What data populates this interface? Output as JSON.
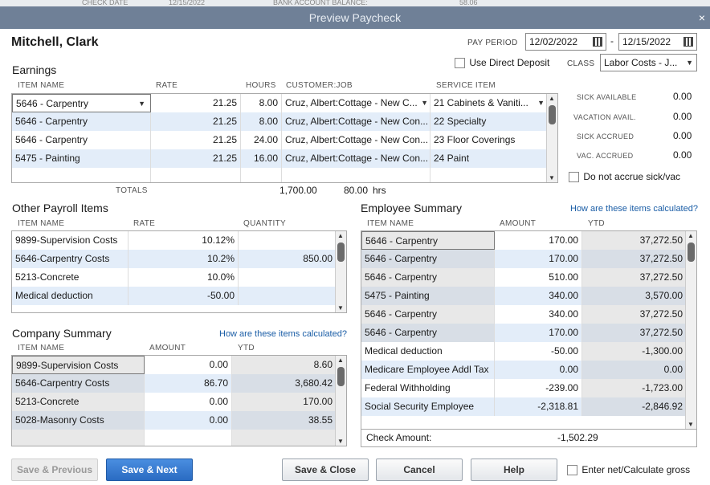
{
  "window": {
    "title": "Preview Paycheck",
    "close": "×"
  },
  "background_strip": {
    "check_date": "CHECK DATE",
    "date": "12/15/2022",
    "bank_balance": "BANK ACCOUNT BALANCE:",
    "balance_value": "58.06"
  },
  "employee": {
    "name": "Mitchell, Clark"
  },
  "pay_period": {
    "label": "PAY PERIOD",
    "start": "12/02/2022",
    "sep": "-",
    "end": "12/15/2022"
  },
  "direct_deposit": {
    "label": "Use Direct Deposit",
    "checked": false
  },
  "class": {
    "label": "CLASS",
    "value": "Labor Costs - J..."
  },
  "earnings": {
    "title": "Earnings",
    "headers": [
      "ITEM NAME",
      "RATE",
      "HOURS",
      "CUSTOMER:JOB",
      "SERVICE ITEM"
    ],
    "rows": [
      {
        "item": "5646 - Carpentry",
        "rate": "21.25",
        "hours": "8.00",
        "job": "Cruz, Albert:Cottage - New C...",
        "service": "21 Cabinets & Vaniti..."
      },
      {
        "item": "5646 - Carpentry",
        "rate": "21.25",
        "hours": "8.00",
        "job": "Cruz, Albert:Cottage - New Con...",
        "service": "22 Specialty"
      },
      {
        "item": "5646 - Carpentry",
        "rate": "21.25",
        "hours": "24.00",
        "job": "Cruz, Albert:Cottage - New Con...",
        "service": "23 Floor Coverings"
      },
      {
        "item": "5475 - Painting",
        "rate": "21.25",
        "hours": "16.00",
        "job": "Cruz, Albert:Cottage - New Con...",
        "service": "24 Paint"
      }
    ],
    "totals_label": "TOTALS",
    "total_amount": "1,700.00",
    "total_hours": "80.00",
    "hours_unit": "hrs"
  },
  "sick_vac": {
    "items": [
      {
        "label": "SICK AVAILABLE",
        "value": "0.00"
      },
      {
        "label": "VACATION AVAIL.",
        "value": "0.00"
      },
      {
        "label": "SICK ACCRUED",
        "value": "0.00"
      },
      {
        "label": "VAC. ACCRUED",
        "value": "0.00"
      }
    ],
    "no_accrue_label": "Do not accrue sick/vac"
  },
  "other_payroll": {
    "title": "Other Payroll Items",
    "headers": [
      "ITEM NAME",
      "RATE",
      "QUANTITY"
    ],
    "rows": [
      {
        "item": "9899-Supervision Costs",
        "rate": "10.12%",
        "qty": ""
      },
      {
        "item": "5646-Carpentry Costs",
        "rate": "10.2%",
        "qty": "850.00"
      },
      {
        "item": "5213-Concrete",
        "rate": "10.0%",
        "qty": ""
      },
      {
        "item": "Medical deduction",
        "rate": "-50.00",
        "qty": ""
      }
    ]
  },
  "company_summary": {
    "title": "Company Summary",
    "link": "How are these items calculated?",
    "headers": [
      "ITEM NAME",
      "AMOUNT",
      "YTD"
    ],
    "rows": [
      {
        "item": "9899-Supervision Costs",
        "amount": "0.00",
        "ytd": "8.60"
      },
      {
        "item": "5646-Carpentry Costs",
        "amount": "86.70",
        "ytd": "3,680.42"
      },
      {
        "item": "5213-Concrete",
        "amount": "0.00",
        "ytd": "170.00"
      },
      {
        "item": "5028-Masonry Costs",
        "amount": "0.00",
        "ytd": "38.55"
      }
    ]
  },
  "employee_summary": {
    "title": "Employee Summary",
    "link": "How are these items calculated?",
    "headers": [
      "ITEM NAME",
      "AMOUNT",
      "YTD"
    ],
    "rows": [
      {
        "item": "5646 - Carpentry",
        "amount": "170.00",
        "ytd": "37,272.50"
      },
      {
        "item": "5646 - Carpentry",
        "amount": "170.00",
        "ytd": "37,272.50"
      },
      {
        "item": "5646 - Carpentry",
        "amount": "510.00",
        "ytd": "37,272.50"
      },
      {
        "item": "5475 - Painting",
        "amount": "340.00",
        "ytd": "3,570.00"
      },
      {
        "item": "5646 - Carpentry",
        "amount": "340.00",
        "ytd": "37,272.50"
      },
      {
        "item": "5646 - Carpentry",
        "amount": "170.00",
        "ytd": "37,272.50"
      },
      {
        "item": "Medical deduction",
        "amount": "-50.00",
        "ytd": "-1,300.00"
      },
      {
        "item": "Medicare Employee Addl Tax",
        "amount": "0.00",
        "ytd": "0.00"
      },
      {
        "item": "Federal Withholding",
        "amount": "-239.00",
        "ytd": "-1,723.00"
      },
      {
        "item": "Social Security Employee",
        "amount": "-2,318.81",
        "ytd": "-2,846.92"
      }
    ],
    "check_amount_label": "Check Amount:",
    "check_amount": "-1,502.29"
  },
  "buttons": {
    "save_previous": "Save & Previous",
    "save_next": "Save & Next",
    "save_close": "Save & Close",
    "cancel": "Cancel",
    "help": "Help"
  },
  "net_gross": {
    "label": "Enter net/Calculate gross",
    "checked": false
  }
}
